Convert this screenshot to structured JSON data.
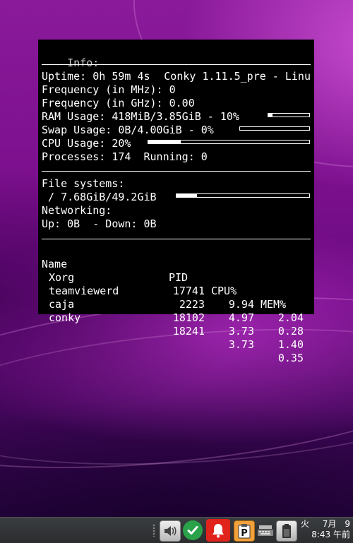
{
  "conky": {
    "info_label": "Info:",
    "title": "Conky 1.11.5_pre - Linu",
    "uptime": "Uptime: 0h 59m 4s",
    "freq_mhz": "Frequency (in MHz): 0",
    "freq_ghz": "Frequency (in GHz): 0.00",
    "ram": "RAM Usage: 418MiB/3.85GiB - 10%",
    "ram_fraction": 0.1,
    "swap": "Swap Usage: 0B/4.00GiB - 0%",
    "swap_fraction": 0.0,
    "cpu": "CPU Usage: 20%",
    "cpu_fraction": 0.2,
    "processes": "Processes: 174  Running: 0",
    "fs_label": "File systems:",
    "fs_root": " / 7.68GiB/49.2GiB",
    "fs_fraction": 0.156,
    "net_label": "Networking:",
    "net_updown": "Up: 0B  - Down: 0B",
    "table": {
      "headers": [
        "Name",
        "PID",
        "CPU%",
        "MEM%"
      ],
      "rows": [
        [
          "Xorg",
          "17741",
          "9.94",
          "2.04"
        ],
        [
          "teamviewerd",
          "2223",
          "4.97",
          "0.28"
        ],
        [
          "caja",
          "18102",
          "3.73",
          "1.40"
        ],
        [
          "conky",
          "18241",
          "3.73",
          "0.35"
        ]
      ]
    }
  },
  "taskbar": {
    "icons": [
      "volume-icon",
      "checkmark-icon",
      "notification-bell-icon",
      "clipboard-icon",
      "keyboard-icon",
      "battery-icon"
    ],
    "clock_day": "火",
    "clock_date": "7月　9",
    "clock_time": "8:43 午前"
  },
  "colors": {
    "notification": "#e0231b",
    "check": "#2aa24a"
  }
}
